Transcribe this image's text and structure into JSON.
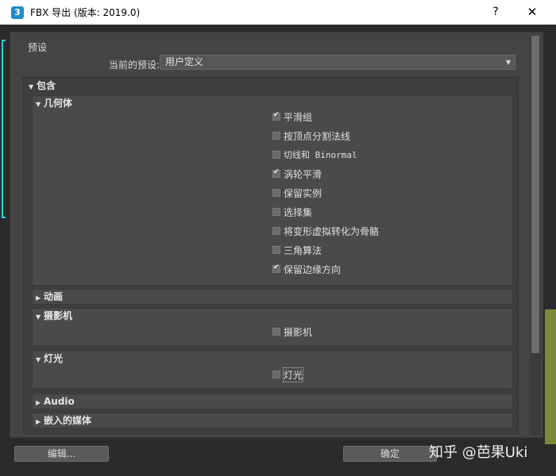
{
  "window": {
    "title": "FBX 导出 (版本: 2019.0)",
    "help": "?",
    "close": "✕",
    "icon_text": "3"
  },
  "preset": {
    "group_label": "预设",
    "current_label": "当前的预设:",
    "value": "用户定义"
  },
  "include": {
    "label": "包含",
    "geometry": {
      "label": "几何体",
      "options": [
        {
          "label": "平滑组",
          "checked": true
        },
        {
          "label": "按顶点分割法线",
          "checked": false
        },
        {
          "label": "切线和 Binormal",
          "checked": false
        },
        {
          "label": "涡轮平滑",
          "checked": true
        },
        {
          "label": "保留实例",
          "checked": false
        },
        {
          "label": "选择集",
          "checked": false
        },
        {
          "label": "将变形虚拟转化为骨骼",
          "checked": false
        },
        {
          "label": "三角算法",
          "checked": false
        },
        {
          "label": "保留边缘方向",
          "checked": true
        }
      ]
    },
    "animation": {
      "label": "动画"
    },
    "camera": {
      "label": "摄影机",
      "option": {
        "label": "摄影机",
        "checked": false
      }
    },
    "light": {
      "label": "灯光",
      "option": {
        "label": "灯光",
        "checked": false
      }
    },
    "audio": {
      "label": "Audio"
    },
    "embed": {
      "label": "嵌入的媒体"
    }
  },
  "buttons": {
    "edit": "编辑...",
    "ok": "确定"
  },
  "watermark": "知乎 @芭果Uki",
  "colors": {
    "accent_cyan": "#2bd4d4",
    "icon_blue": "#1f8ec7"
  }
}
